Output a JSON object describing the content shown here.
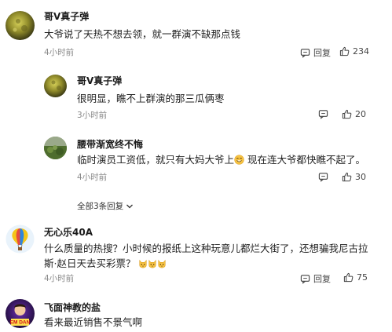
{
  "comments": [
    {
      "username": "哥V真子弹",
      "text": "大爷说了天热不想去领，就一群演不缺那点钱",
      "time": "4小时前",
      "reply_label": "回复",
      "likes": "234",
      "replies": [
        {
          "username": "哥V真子弹",
          "text": "很明显，瞧不上群演的那三瓜俩枣",
          "time": "3小时前",
          "likes": "20"
        },
        {
          "username": "腰带渐宽终不悔",
          "text_before": "临时演员工资低，就只有大妈大爷上",
          "text_after": " 现在连大爷都快瞧不起了。",
          "time": "4小时前",
          "likes": "30"
        }
      ],
      "show_all_replies": "全部3条回复"
    },
    {
      "username": "无心乐40A",
      "text": "什么质量的热搜？小时候的报纸上这种玩意儿都烂大街了，还想骗我尼古拉斯·赵日天去买彩票？",
      "time": "4小时前",
      "reply_label": "回复",
      "likes": "75"
    },
    {
      "username": "飞面神教的盐",
      "text": "看来最近销售不景气啊",
      "avatar_text": "EM DAN"
    }
  ]
}
